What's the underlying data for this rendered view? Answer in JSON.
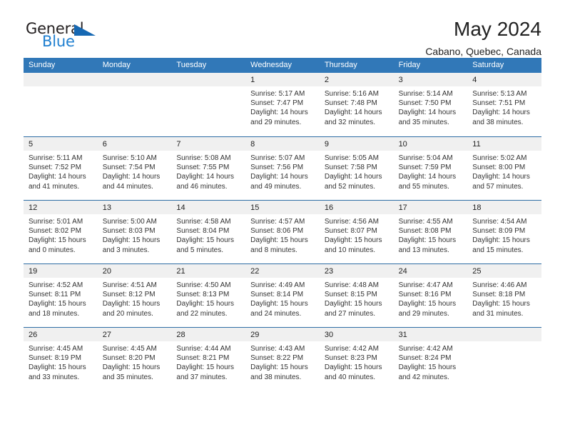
{
  "brand": {
    "name_top": "General",
    "name_bottom": "Blue",
    "triangle_color": "#1668b3",
    "blue_color": "#1f7fd0"
  },
  "header": {
    "title": "May 2024",
    "subtitle": "Cabano, Quebec, Canada"
  },
  "theme": {
    "header_blue": "#3178b8",
    "row_divider": "#2e6da4",
    "daynum_band": "#f0f0f0"
  },
  "weekdays": [
    "Sunday",
    "Monday",
    "Tuesday",
    "Wednesday",
    "Thursday",
    "Friday",
    "Saturday"
  ],
  "weeks": [
    [
      {
        "day": "",
        "sunrise": "",
        "sunset": "",
        "daylight_1": "",
        "daylight_2": ""
      },
      {
        "day": "",
        "sunrise": "",
        "sunset": "",
        "daylight_1": "",
        "daylight_2": ""
      },
      {
        "day": "",
        "sunrise": "",
        "sunset": "",
        "daylight_1": "",
        "daylight_2": ""
      },
      {
        "day": "1",
        "sunrise": "Sunrise: 5:17 AM",
        "sunset": "Sunset: 7:47 PM",
        "daylight_1": "Daylight: 14 hours",
        "daylight_2": "and 29 minutes."
      },
      {
        "day": "2",
        "sunrise": "Sunrise: 5:16 AM",
        "sunset": "Sunset: 7:48 PM",
        "daylight_1": "Daylight: 14 hours",
        "daylight_2": "and 32 minutes."
      },
      {
        "day": "3",
        "sunrise": "Sunrise: 5:14 AM",
        "sunset": "Sunset: 7:50 PM",
        "daylight_1": "Daylight: 14 hours",
        "daylight_2": "and 35 minutes."
      },
      {
        "day": "4",
        "sunrise": "Sunrise: 5:13 AM",
        "sunset": "Sunset: 7:51 PM",
        "daylight_1": "Daylight: 14 hours",
        "daylight_2": "and 38 minutes."
      }
    ],
    [
      {
        "day": "5",
        "sunrise": "Sunrise: 5:11 AM",
        "sunset": "Sunset: 7:52 PM",
        "daylight_1": "Daylight: 14 hours",
        "daylight_2": "and 41 minutes."
      },
      {
        "day": "6",
        "sunrise": "Sunrise: 5:10 AM",
        "sunset": "Sunset: 7:54 PM",
        "daylight_1": "Daylight: 14 hours",
        "daylight_2": "and 44 minutes."
      },
      {
        "day": "7",
        "sunrise": "Sunrise: 5:08 AM",
        "sunset": "Sunset: 7:55 PM",
        "daylight_1": "Daylight: 14 hours",
        "daylight_2": "and 46 minutes."
      },
      {
        "day": "8",
        "sunrise": "Sunrise: 5:07 AM",
        "sunset": "Sunset: 7:56 PM",
        "daylight_1": "Daylight: 14 hours",
        "daylight_2": "and 49 minutes."
      },
      {
        "day": "9",
        "sunrise": "Sunrise: 5:05 AM",
        "sunset": "Sunset: 7:58 PM",
        "daylight_1": "Daylight: 14 hours",
        "daylight_2": "and 52 minutes."
      },
      {
        "day": "10",
        "sunrise": "Sunrise: 5:04 AM",
        "sunset": "Sunset: 7:59 PM",
        "daylight_1": "Daylight: 14 hours",
        "daylight_2": "and 55 minutes."
      },
      {
        "day": "11",
        "sunrise": "Sunrise: 5:02 AM",
        "sunset": "Sunset: 8:00 PM",
        "daylight_1": "Daylight: 14 hours",
        "daylight_2": "and 57 minutes."
      }
    ],
    [
      {
        "day": "12",
        "sunrise": "Sunrise: 5:01 AM",
        "sunset": "Sunset: 8:02 PM",
        "daylight_1": "Daylight: 15 hours",
        "daylight_2": "and 0 minutes."
      },
      {
        "day": "13",
        "sunrise": "Sunrise: 5:00 AM",
        "sunset": "Sunset: 8:03 PM",
        "daylight_1": "Daylight: 15 hours",
        "daylight_2": "and 3 minutes."
      },
      {
        "day": "14",
        "sunrise": "Sunrise: 4:58 AM",
        "sunset": "Sunset: 8:04 PM",
        "daylight_1": "Daylight: 15 hours",
        "daylight_2": "and 5 minutes."
      },
      {
        "day": "15",
        "sunrise": "Sunrise: 4:57 AM",
        "sunset": "Sunset: 8:06 PM",
        "daylight_1": "Daylight: 15 hours",
        "daylight_2": "and 8 minutes."
      },
      {
        "day": "16",
        "sunrise": "Sunrise: 4:56 AM",
        "sunset": "Sunset: 8:07 PM",
        "daylight_1": "Daylight: 15 hours",
        "daylight_2": "and 10 minutes."
      },
      {
        "day": "17",
        "sunrise": "Sunrise: 4:55 AM",
        "sunset": "Sunset: 8:08 PM",
        "daylight_1": "Daylight: 15 hours",
        "daylight_2": "and 13 minutes."
      },
      {
        "day": "18",
        "sunrise": "Sunrise: 4:54 AM",
        "sunset": "Sunset: 8:09 PM",
        "daylight_1": "Daylight: 15 hours",
        "daylight_2": "and 15 minutes."
      }
    ],
    [
      {
        "day": "19",
        "sunrise": "Sunrise: 4:52 AM",
        "sunset": "Sunset: 8:11 PM",
        "daylight_1": "Daylight: 15 hours",
        "daylight_2": "and 18 minutes."
      },
      {
        "day": "20",
        "sunrise": "Sunrise: 4:51 AM",
        "sunset": "Sunset: 8:12 PM",
        "daylight_1": "Daylight: 15 hours",
        "daylight_2": "and 20 minutes."
      },
      {
        "day": "21",
        "sunrise": "Sunrise: 4:50 AM",
        "sunset": "Sunset: 8:13 PM",
        "daylight_1": "Daylight: 15 hours",
        "daylight_2": "and 22 minutes."
      },
      {
        "day": "22",
        "sunrise": "Sunrise: 4:49 AM",
        "sunset": "Sunset: 8:14 PM",
        "daylight_1": "Daylight: 15 hours",
        "daylight_2": "and 24 minutes."
      },
      {
        "day": "23",
        "sunrise": "Sunrise: 4:48 AM",
        "sunset": "Sunset: 8:15 PM",
        "daylight_1": "Daylight: 15 hours",
        "daylight_2": "and 27 minutes."
      },
      {
        "day": "24",
        "sunrise": "Sunrise: 4:47 AM",
        "sunset": "Sunset: 8:16 PM",
        "daylight_1": "Daylight: 15 hours",
        "daylight_2": "and 29 minutes."
      },
      {
        "day": "25",
        "sunrise": "Sunrise: 4:46 AM",
        "sunset": "Sunset: 8:18 PM",
        "daylight_1": "Daylight: 15 hours",
        "daylight_2": "and 31 minutes."
      }
    ],
    [
      {
        "day": "26",
        "sunrise": "Sunrise: 4:45 AM",
        "sunset": "Sunset: 8:19 PM",
        "daylight_1": "Daylight: 15 hours",
        "daylight_2": "and 33 minutes."
      },
      {
        "day": "27",
        "sunrise": "Sunrise: 4:45 AM",
        "sunset": "Sunset: 8:20 PM",
        "daylight_1": "Daylight: 15 hours",
        "daylight_2": "and 35 minutes."
      },
      {
        "day": "28",
        "sunrise": "Sunrise: 4:44 AM",
        "sunset": "Sunset: 8:21 PM",
        "daylight_1": "Daylight: 15 hours",
        "daylight_2": "and 37 minutes."
      },
      {
        "day": "29",
        "sunrise": "Sunrise: 4:43 AM",
        "sunset": "Sunset: 8:22 PM",
        "daylight_1": "Daylight: 15 hours",
        "daylight_2": "and 38 minutes."
      },
      {
        "day": "30",
        "sunrise": "Sunrise: 4:42 AM",
        "sunset": "Sunset: 8:23 PM",
        "daylight_1": "Daylight: 15 hours",
        "daylight_2": "and 40 minutes."
      },
      {
        "day": "31",
        "sunrise": "Sunrise: 4:42 AM",
        "sunset": "Sunset: 8:24 PM",
        "daylight_1": "Daylight: 15 hours",
        "daylight_2": "and 42 minutes."
      },
      {
        "day": "",
        "sunrise": "",
        "sunset": "",
        "daylight_1": "",
        "daylight_2": ""
      }
    ]
  ]
}
